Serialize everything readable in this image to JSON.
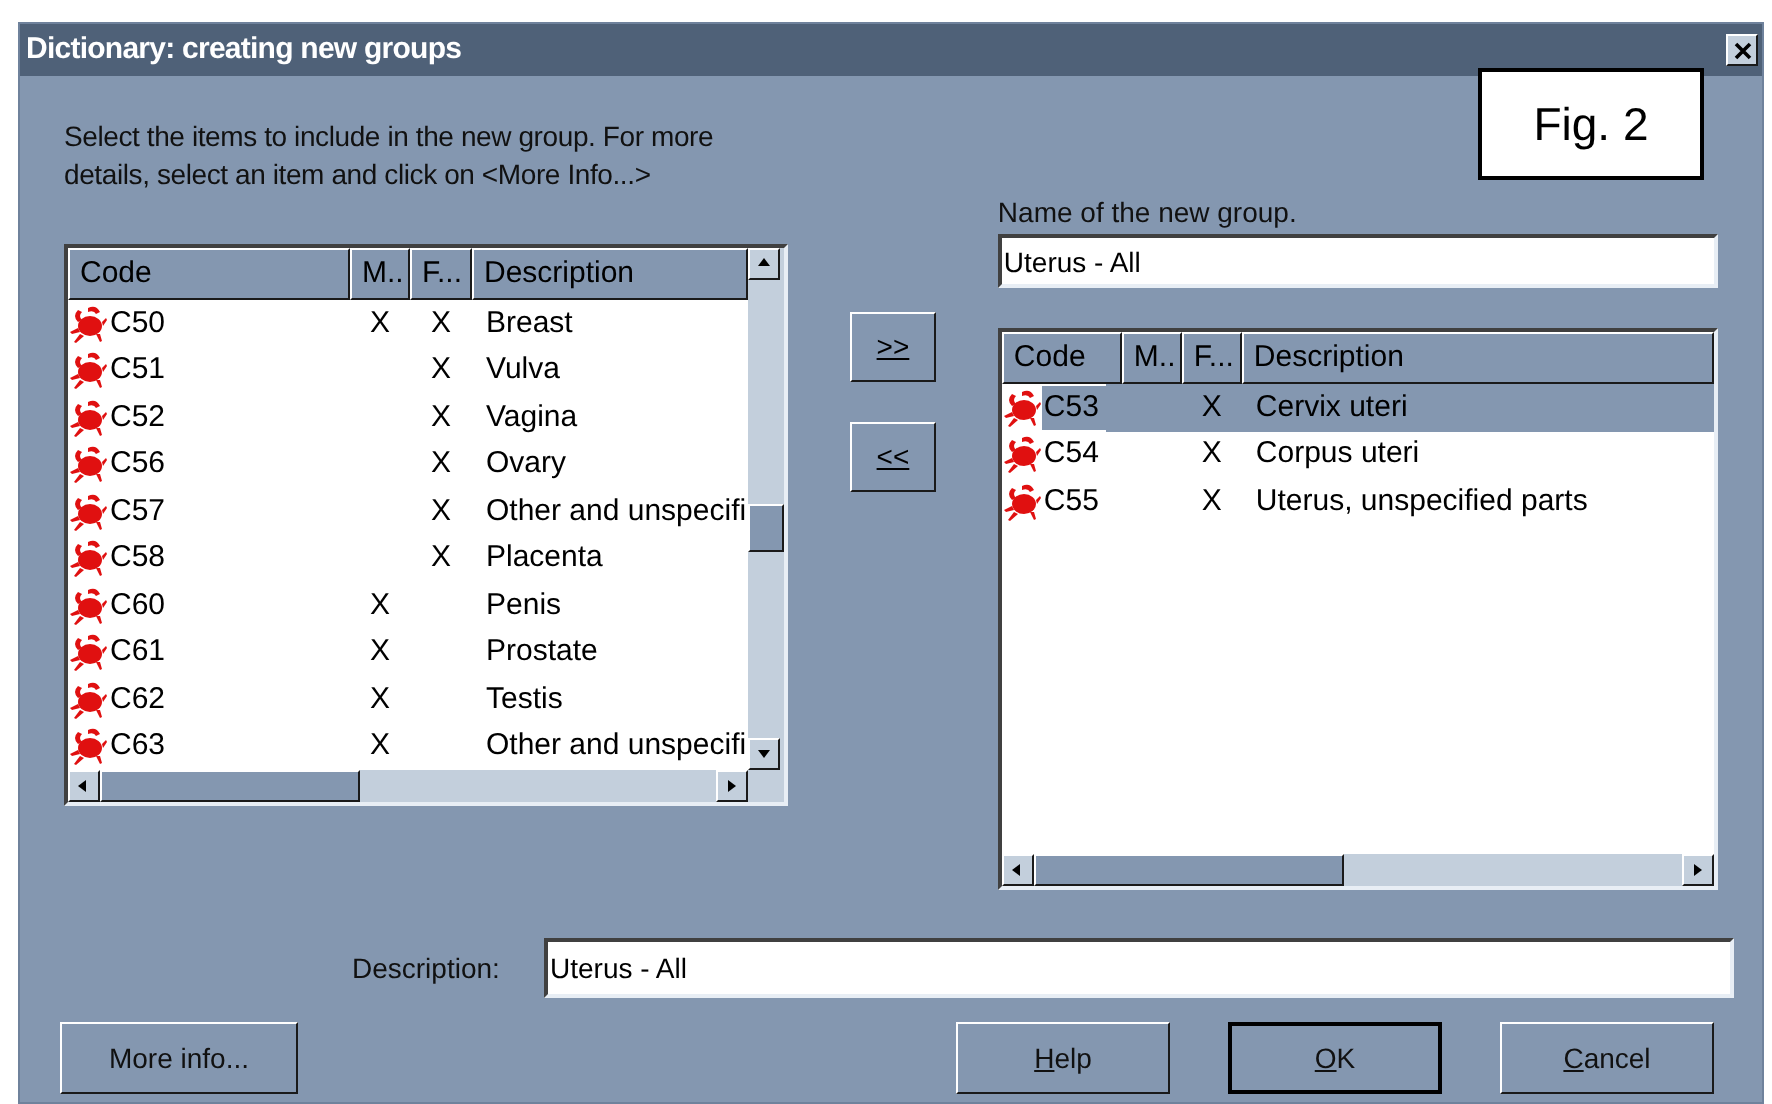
{
  "window": {
    "title": "Dictionary: creating new groups"
  },
  "figure_label": "Fig. 2",
  "instructions": "Select the items to include in the new group. For more details, select an item and click on <More Info...>",
  "group_name": {
    "label": "Name of the new group.",
    "value": "Uterus - All"
  },
  "available_list": {
    "columns": [
      "Code",
      "M..",
      "F...",
      "Description"
    ],
    "rows": [
      {
        "code": "C50",
        "m": "X",
        "f": "X",
        "description": "Breast",
        "selected": false
      },
      {
        "code": "C51",
        "m": "",
        "f": "X",
        "description": "Vulva",
        "selected": false
      },
      {
        "code": "C52",
        "m": "",
        "f": "X",
        "description": "Vagina",
        "selected": false
      },
      {
        "code": "C56",
        "m": "",
        "f": "X",
        "description": "Ovary",
        "selected": false
      },
      {
        "code": "C57",
        "m": "",
        "f": "X",
        "description": "Other and unspecifi",
        "selected": false
      },
      {
        "code": "C58",
        "m": "",
        "f": "X",
        "description": "Placenta",
        "selected": false
      },
      {
        "code": "C60",
        "m": "X",
        "f": "",
        "description": "Penis",
        "selected": false
      },
      {
        "code": "C61",
        "m": "X",
        "f": "",
        "description": "Prostate",
        "selected": false
      },
      {
        "code": "C62",
        "m": "X",
        "f": "",
        "description": "Testis",
        "selected": false
      },
      {
        "code": "C63",
        "m": "X",
        "f": "",
        "description": "Other and unspecifi",
        "selected": false
      }
    ]
  },
  "move_buttons": [
    ">>",
    "<<"
  ],
  "group_list": {
    "columns": [
      "Code",
      "M..",
      "F...",
      "Description"
    ],
    "rows": [
      {
        "code": "C53",
        "m": "",
        "f": "X",
        "description": "Cervix uteri",
        "selected": true
      },
      {
        "code": "C54",
        "m": "",
        "f": "X",
        "description": "Corpus uteri",
        "selected": false
      },
      {
        "code": "C55",
        "m": "",
        "f": "X",
        "description": "Uterus, unspecified parts",
        "selected": false
      }
    ]
  },
  "description": {
    "label": "Description:",
    "value": "Uterus - All"
  },
  "buttons": [
    {
      "label": "More info...",
      "default": false
    },
    {
      "label": "Help",
      "default": false
    },
    {
      "label": "OK",
      "default": true
    },
    {
      "label": "Cancel",
      "default": false
    }
  ]
}
